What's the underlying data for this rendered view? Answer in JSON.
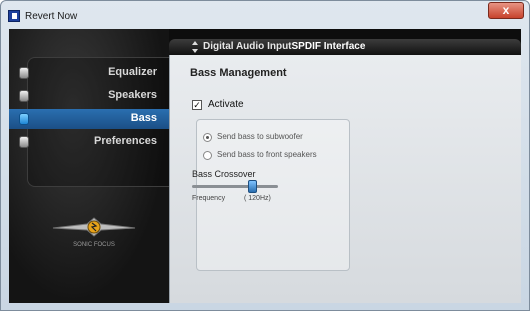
{
  "window": {
    "title": "Revert Now",
    "close_label": "x"
  },
  "sidebar": {
    "items": [
      {
        "label": "Equalizer",
        "active": false
      },
      {
        "label": "Speakers",
        "active": false
      },
      {
        "label": "Bass",
        "active": true
      },
      {
        "label": "Preferences",
        "active": false
      }
    ],
    "logo_text": "SONIC FOCUS"
  },
  "header": {
    "prefix": "Digital Audio Input",
    "value": "SPDIF Interface"
  },
  "bass": {
    "title": "Bass Management",
    "activate_label": "Activate",
    "activate_checked": true,
    "activate_check_glyph": "✓",
    "radio_options": [
      {
        "label": "Send bass to subwoofer",
        "checked": true
      },
      {
        "label": "Send bass to front speakers",
        "checked": false
      }
    ],
    "crossover": {
      "title": "Bass Crossover",
      "frequency_label": "Frequency",
      "frequency_value": "( 120Hz)",
      "slider_fraction": 0.7
    }
  },
  "colors": {
    "accent": "#2a6fb0",
    "close": "#c7432c"
  }
}
